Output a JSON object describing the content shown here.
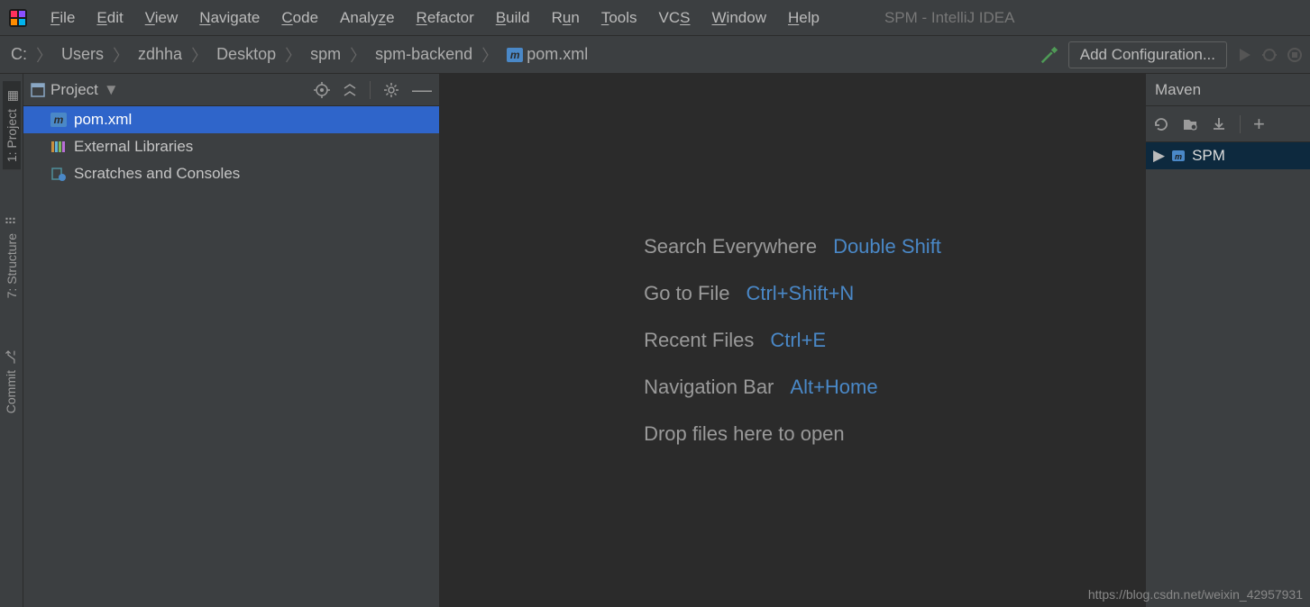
{
  "window_title": "SPM - IntelliJ IDEA",
  "menu": [
    "File",
    "Edit",
    "View",
    "Navigate",
    "Code",
    "Analyze",
    "Refactor",
    "Build",
    "Run",
    "Tools",
    "VCS",
    "Window",
    "Help"
  ],
  "breadcrumb": [
    "C:",
    "Users",
    "zdhha",
    "Desktop",
    "spm",
    "spm-backend",
    "pom.xml"
  ],
  "config_button": "Add Configuration...",
  "left_tabs": {
    "project": "1: Project",
    "structure": "7: Structure",
    "commit": "Commit"
  },
  "project_panel": {
    "title": "Project",
    "items": [
      {
        "label": "pom.xml",
        "icon": "m",
        "selected": true
      },
      {
        "label": "External Libraries",
        "icon": "lib"
      },
      {
        "label": "Scratches and Consoles",
        "icon": "scratch"
      }
    ]
  },
  "editor_hints": [
    {
      "label": "Search Everywhere",
      "key": "Double Shift"
    },
    {
      "label": "Go to File",
      "key": "Ctrl+Shift+N"
    },
    {
      "label": "Recent Files",
      "key": "Ctrl+E"
    },
    {
      "label": "Navigation Bar",
      "key": "Alt+Home"
    }
  ],
  "editor_drop_text": "Drop files here to open",
  "maven": {
    "title": "Maven",
    "project": "SPM"
  },
  "watermark": "https://blog.csdn.net/weixin_42957931"
}
